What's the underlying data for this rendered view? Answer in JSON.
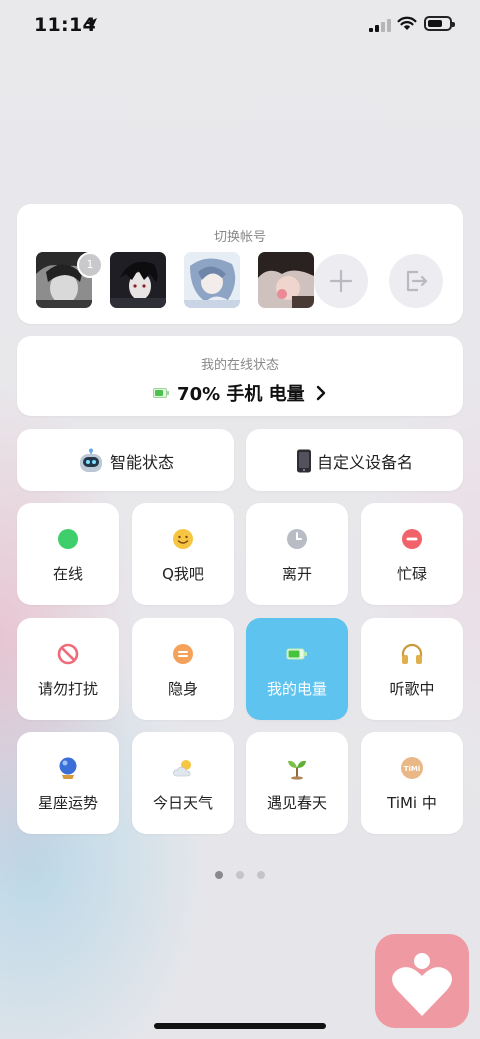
{
  "status_bar": {
    "time": "11:14",
    "icons": [
      "location-arrow-icon",
      "cellular-signal-icon",
      "wifi-icon",
      "battery-icon"
    ]
  },
  "account": {
    "title": "切换帐号",
    "badge_count": "1",
    "avatars": [
      "avatar-1",
      "avatar-2",
      "avatar-3",
      "avatar-4"
    ],
    "add_icon": "plus-icon",
    "logout_icon": "logout-icon"
  },
  "online_status": {
    "title": "我的在线状态",
    "battery_text": "70% 手机 电量",
    "chevron": "chevron-right-icon"
  },
  "buttons": {
    "smart_status": "智能状态",
    "custom_device": "自定义设备名"
  },
  "tiles": [
    {
      "label": "在线",
      "icon": "green-dot-icon",
      "active": false
    },
    {
      "label": "Q我吧",
      "icon": "smiley-icon",
      "active": false
    },
    {
      "label": "离开",
      "icon": "clock-icon",
      "active": false
    },
    {
      "label": "忙碌",
      "icon": "minus-circle-icon",
      "active": false
    },
    {
      "label": "请勿打扰",
      "icon": "no-entry-icon",
      "active": false
    },
    {
      "label": "隐身",
      "icon": "equals-circle-icon",
      "active": false
    },
    {
      "label": "我的电量",
      "icon": "battery-icon",
      "active": true
    },
    {
      "label": "听歌中",
      "icon": "headphones-icon",
      "active": false
    },
    {
      "label": "星座运势",
      "icon": "crystal-ball-icon",
      "active": false
    },
    {
      "label": "今日天气",
      "icon": "weather-icon",
      "active": false
    },
    {
      "label": "遇见春天",
      "icon": "sprout-icon",
      "active": false
    },
    {
      "label": "TiMi 中",
      "icon": "timi-icon",
      "active": false
    }
  ],
  "timi_badge_text": "TiMi",
  "colors": {
    "accent_tile": "#5ec3ef",
    "online_green": "#3ecf6c",
    "busy_red": "#f0636a",
    "app_icon_pink": "#ef9aa2"
  },
  "pagination": {
    "pages": 3,
    "current": 1
  }
}
